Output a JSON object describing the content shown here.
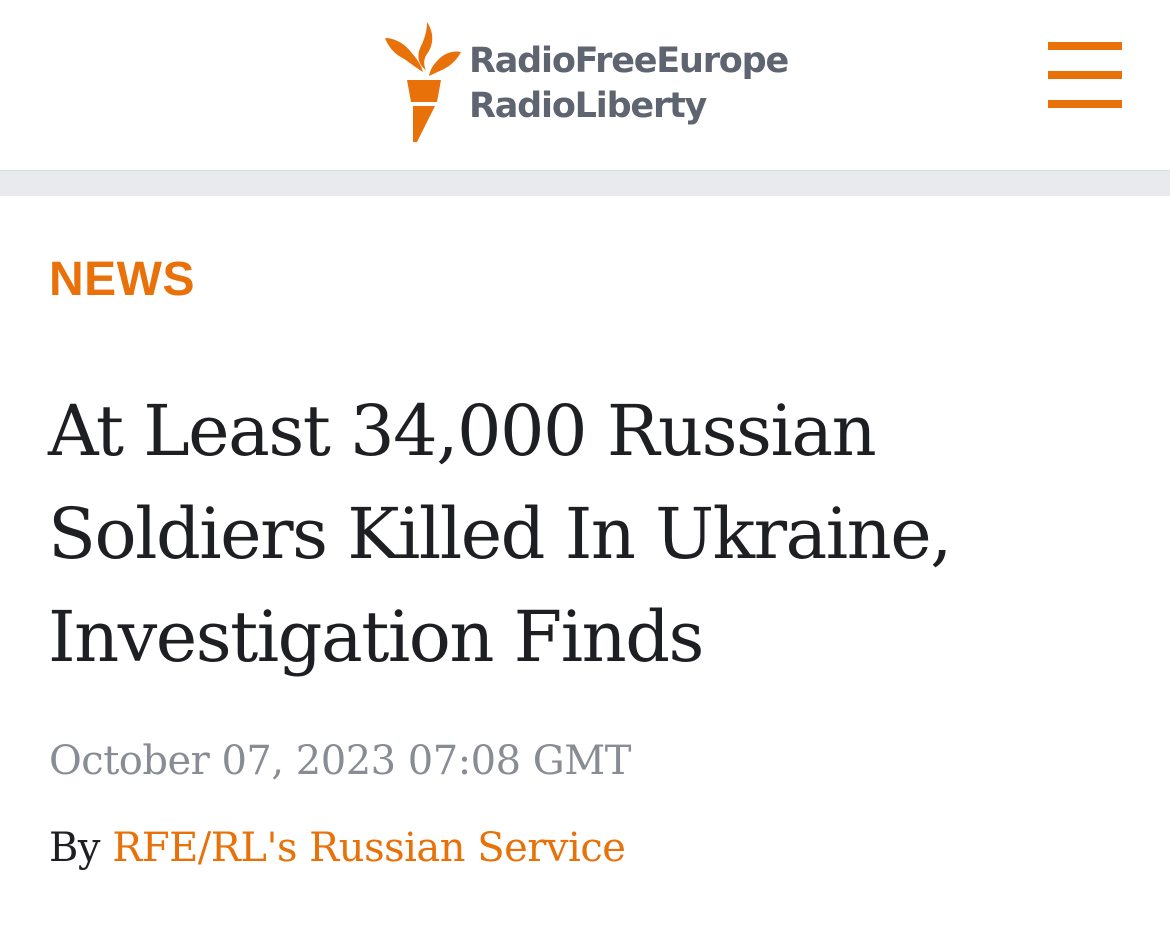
{
  "header": {
    "logo_line1": "RadioFreeEurope",
    "logo_line2": "RadioLiberty",
    "menu_icon": "hamburger-menu-icon",
    "logo_icon": "torch-icon"
  },
  "article": {
    "category": "NEWS",
    "headline": "At Least 34,000 Russian Soldiers Killed In Ukraine, Investigation Finds",
    "date": "October 07, 2023 07:08 GMT",
    "byline_prefix": "By",
    "author": "RFE/RL's Russian Service"
  },
  "colors": {
    "accent": "#e8710a",
    "logo_text": "#5e6470",
    "headline": "#1e1f23",
    "date": "#888c94",
    "divider": "#e9eaed"
  }
}
